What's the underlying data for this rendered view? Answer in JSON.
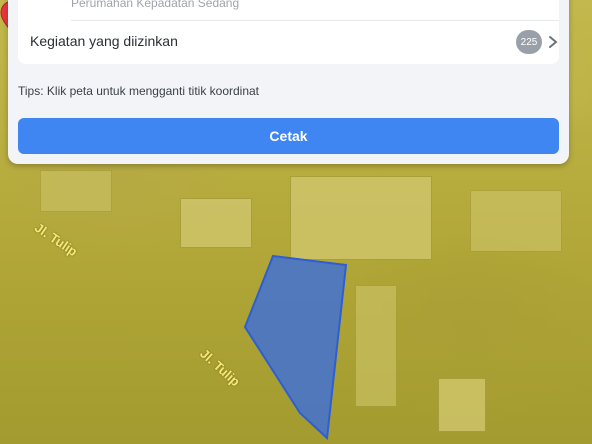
{
  "card": {
    "subtext": "Perumahan Kepadatan Sedang",
    "row_label": "Kegiatan yang diizinkan",
    "badge_count": "225",
    "tips": "Tips: Klik peta untuk mengganti titik koordinat",
    "print_label": "Cetak"
  },
  "map": {
    "road_labels": [
      "Jl. Tulip",
      "Jl. Tulip"
    ],
    "parcel_color": "#3d6fd9",
    "overlay_color": "#c7bb3f"
  },
  "colors": {
    "primary_button": "#3f86f3",
    "badge": "#9aa0aa"
  },
  "icons": {
    "marker": "map-marker-icon",
    "chevron": "chevron-right-icon"
  }
}
